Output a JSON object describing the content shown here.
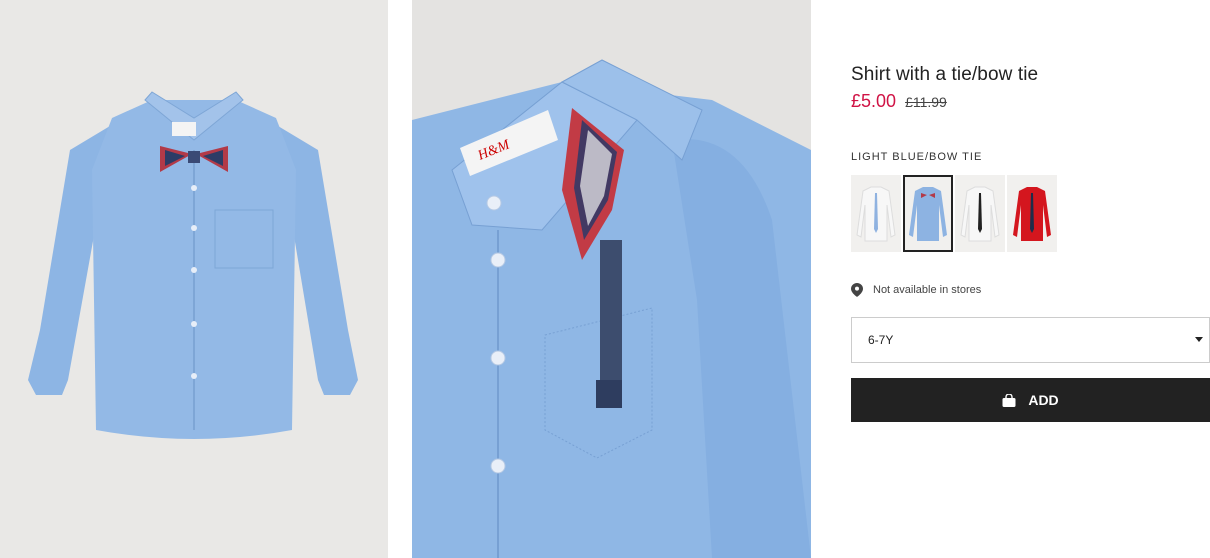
{
  "product": {
    "title": "Shirt with a tie/bow tie",
    "price_sale": "£5.00",
    "price_original": "£11.99"
  },
  "color": {
    "label": "LIGHT BLUE/BOW TIE",
    "options": [
      {
        "name": "white-with-blue-tie",
        "shirt": "#f5f5f5",
        "tie": "#8fb2e0"
      },
      {
        "name": "light-blue-with-bow-tie",
        "shirt": "#8db3e2",
        "tie": "#b33a48",
        "selected": true
      },
      {
        "name": "white-with-black-tie",
        "shirt": "#f5f5f5",
        "tie": "#222222"
      },
      {
        "name": "red-with-navy-tie",
        "shirt": "#d4161e",
        "tie": "#1f2d4a"
      }
    ]
  },
  "availability": {
    "text": "Not available in stores",
    "icon": "location-pin-icon"
  },
  "size": {
    "selected": "6-7Y"
  },
  "cart": {
    "add_label": "ADD",
    "icon": "shopping-bag-icon"
  },
  "images": {
    "brand_tag": "H&M"
  },
  "colors": {
    "sale_red": "#d01345",
    "button_black": "#222222",
    "shirt_blue": "#8db3e2"
  }
}
